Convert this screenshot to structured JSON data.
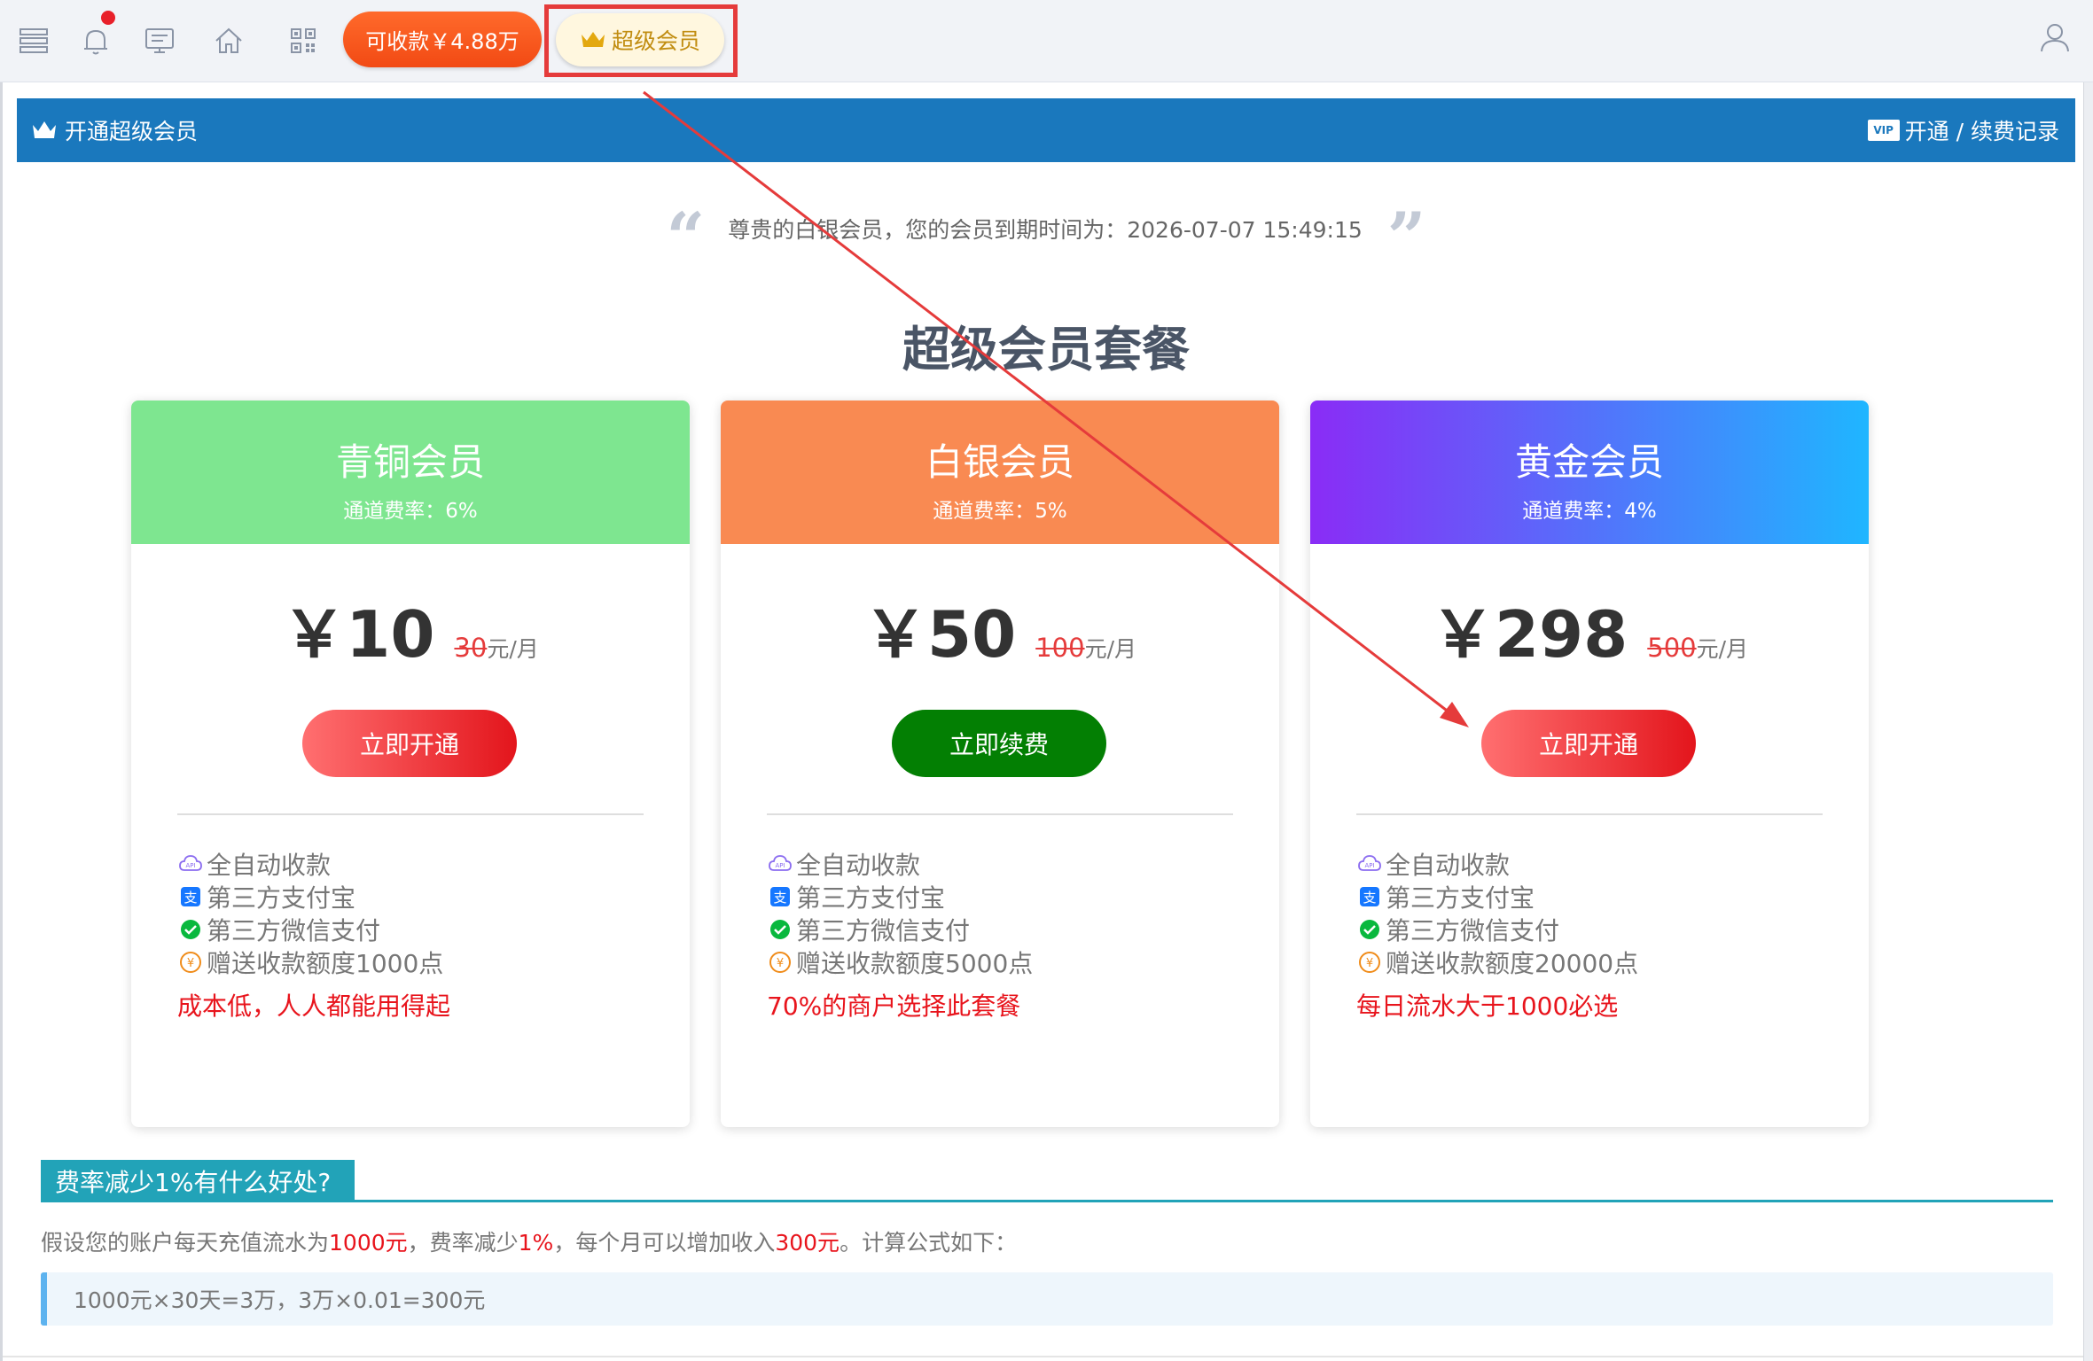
{
  "topbar": {
    "receivable_label": "可收款￥4.88万",
    "vip_label": "超级会员",
    "notification_dot_color": "#e8202a"
  },
  "header": {
    "title": "开通超级会员",
    "records_link": "开通 / 续费记录",
    "vip_tag": "VIP",
    "bg_color": "#1a78bd"
  },
  "notice": {
    "text": "尊贵的白银会员，您的会员到期时间为：2026-07-07 15:49:15",
    "open_quote": "“",
    "close_quote": "”"
  },
  "page_title": "超级会员套餐",
  "plans": [
    {
      "name": "青铜会员",
      "rate": "通道费率：6%",
      "price": "￥10",
      "old_price": "30",
      "unit": "元/月",
      "button": "立即开通",
      "features": [
        "全自动收款",
        "第三方支付宝",
        "第三方微信支付",
        "赠送收款额度1000点"
      ],
      "note": "成本低，人人都能用得起",
      "header_color": "#7ee690"
    },
    {
      "name": "白银会员",
      "rate": "通道费率：5%",
      "price": "￥50",
      "old_price": "100",
      "unit": "元/月",
      "button": "立即续费",
      "features": [
        "全自动收款",
        "第三方支付宝",
        "第三方微信支付",
        "赠送收款额度5000点"
      ],
      "note": "70%的商户选择此套餐",
      "header_color": "#f98a52"
    },
    {
      "name": "黄金会员",
      "rate": "通道费率：4%",
      "price": "￥298",
      "old_price": "500",
      "unit": "元/月",
      "button": "立即开通",
      "features": [
        "全自动收款",
        "第三方支付宝",
        "第三方微信支付",
        "赠送收款额度20000点"
      ],
      "note": "每日流水大于1000必选",
      "header_color": "#8a2cf6"
    }
  ],
  "benefit": {
    "tab_title": "费率减少1%有什么好处?",
    "text_1": "假设您的账户每天充值流水为",
    "amount": "1000元",
    "text_2": "，费率减少",
    "rate": "1%",
    "text_3": "，每个月可以增加收入",
    "income": "300元",
    "text_4": "。计算公式如下：",
    "formula": "1000元×30天=3万，3万×0.01=300元"
  }
}
